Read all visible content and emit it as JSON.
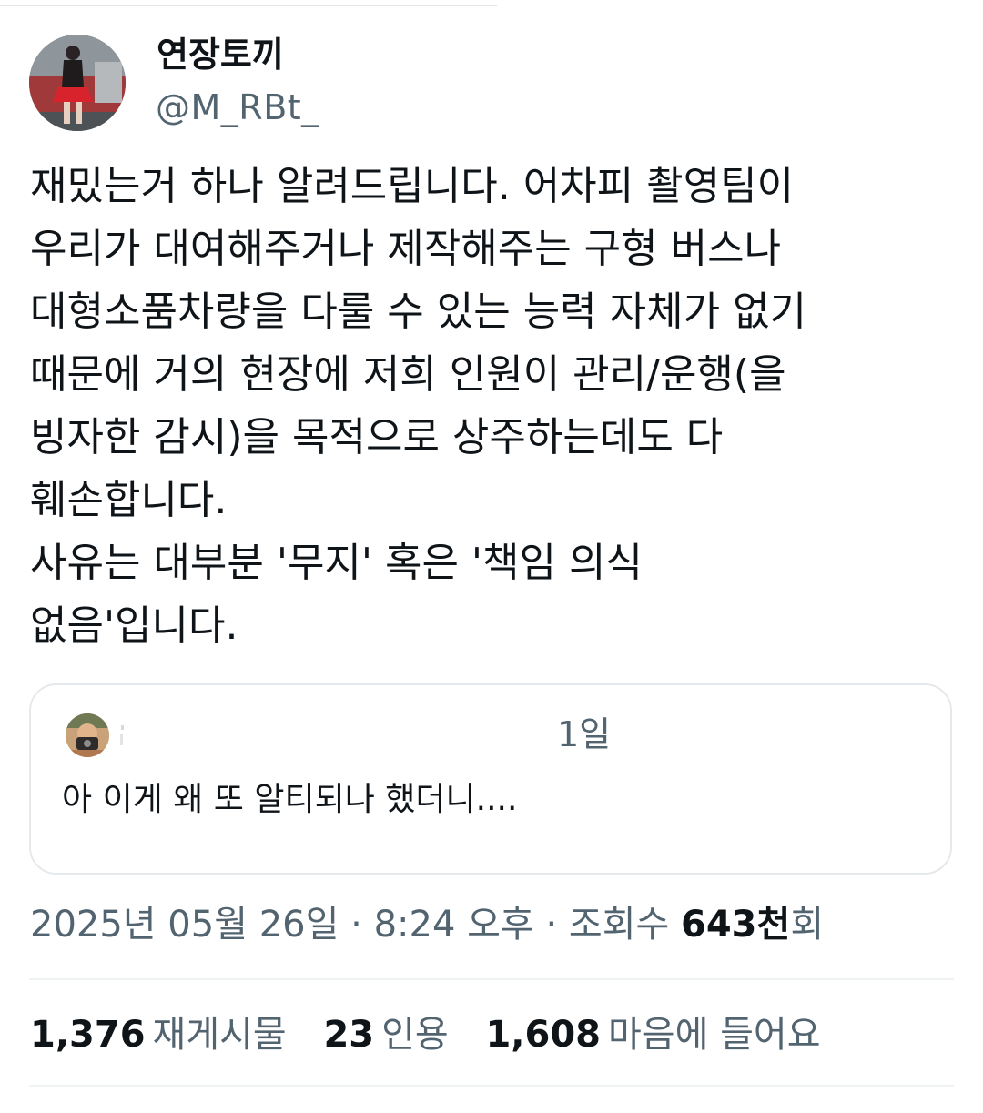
{
  "author": {
    "name": "연장토끼",
    "handle": "@M_RBt_"
  },
  "tweet": {
    "lines": [
      "재밌는거 하나 알려드립니다. 어차피 촬영팀이",
      "우리가 대여해주거나 제작해주는 구형 버스나",
      "대형소품차량을 다룰 수 있는 능력 자체가 없기",
      "때문에 거의 현장에 저희 인원이 관리/운행(을",
      "빙자한 감시)을 목적으로 상주하는데도 다",
      "훼손합니다.",
      "사유는 대부분 '무지' 혹은 '책임 의식",
      "없음'입니다."
    ]
  },
  "quoted_tweet": {
    "time": "1일",
    "text": "아 이게 왜 또 알티되나 했더니...."
  },
  "meta": {
    "date": "2025년 05월 26일",
    "separator": "·",
    "time": "8:24 오후",
    "views_label": "조회수",
    "views_count": "643천",
    "views_suffix": "회"
  },
  "stats": {
    "reposts_count": "1,376",
    "reposts_label": "재게시물",
    "quotes_count": "23",
    "quotes_label": "인용",
    "likes_count": "1,608",
    "likes_label": "마음에 들어요"
  },
  "colors": {
    "primary_text": "#0f1419",
    "secondary_text": "#536471",
    "divider": "#eff3f4",
    "card_border": "#e6e9eb"
  },
  "icons": {
    "author_avatar": "profile-photo",
    "quoted_avatar": "profile-photo"
  }
}
